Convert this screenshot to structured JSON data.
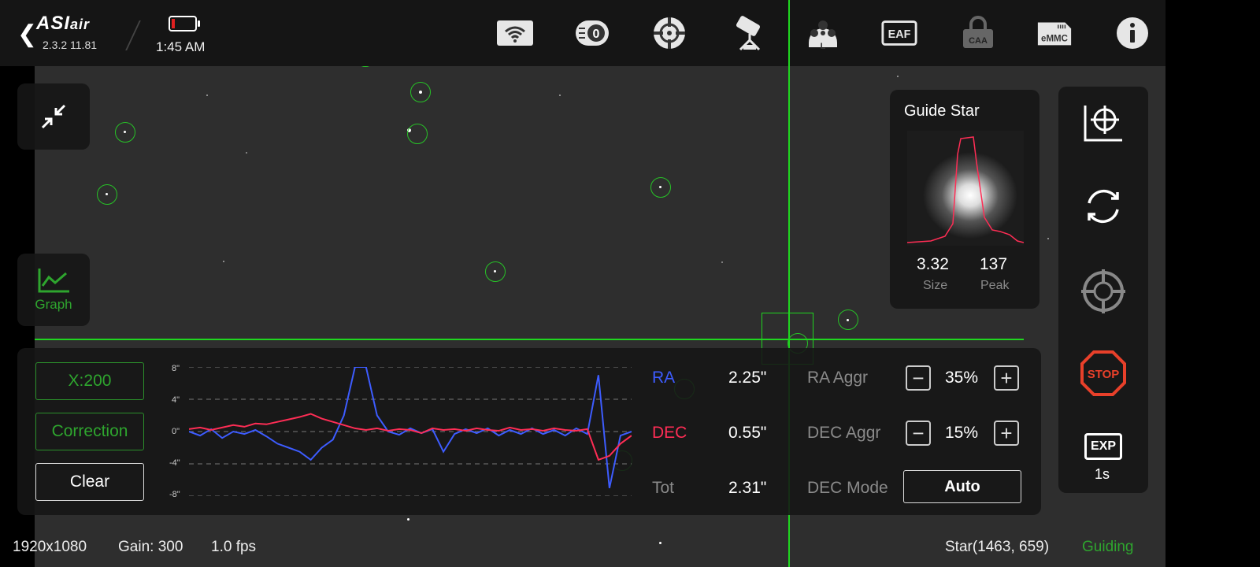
{
  "app": {
    "name": "ASIair",
    "version": "2.3.2 11.81",
    "time": "1:45 AM"
  },
  "toolbar_icons": [
    "wifi-icon",
    "focuser-0-icon",
    "crosshair-target-icon",
    "telescope-mount-icon",
    "filter-wheel-L-icon",
    "eaf-icon",
    "caa-icon",
    "emmc-icon",
    "info-icon"
  ],
  "toolbar_text": {
    "filter": "L",
    "eaf": "EAF",
    "caa": "CAA",
    "emmc": "eMMC"
  },
  "left": {
    "graph_label": "Graph"
  },
  "guide_star": {
    "title": "Guide Star",
    "size_value": "3.32",
    "size_label": "Size",
    "peak_value": "137",
    "peak_label": "Peak"
  },
  "right_panel": {
    "stop_label": "STOP",
    "exp_label": "EXP",
    "exp_value": "1s"
  },
  "graph": {
    "scale_button": "X:200",
    "correction_button": "Correction",
    "clear_button": "Clear",
    "y_ticks": [
      "8\"",
      "4\"",
      "0\"",
      "-4\"",
      "-8\""
    ],
    "ra_label": "RA",
    "ra_value": "2.25\"",
    "dec_label": "DEC",
    "dec_value": "0.55\"",
    "tot_label": "Tot",
    "tot_value": "2.31\"",
    "ra_aggr_label": "RA Aggr",
    "ra_aggr_value": "35%",
    "dec_aggr_label": "DEC Aggr",
    "dec_aggr_value": "15%",
    "dec_mode_label": "DEC Mode",
    "dec_mode_value": "Auto",
    "minus": "−",
    "plus": "+"
  },
  "status": {
    "resolution": "1920x1080",
    "gain": "Gain: 300",
    "fps": "1.0 fps",
    "star": "Star(1463, 659)",
    "state": "Guiding"
  },
  "colors": {
    "accent_green": "#2ea52e",
    "crosshair": "#1fd61f",
    "ra": "#3d5cff",
    "dec": "#ff2d55",
    "stop": "#e8402a"
  },
  "chart_data": {
    "type": "line",
    "ylim": [
      -8,
      8
    ],
    "x": [
      0,
      5,
      10,
      15,
      20,
      25,
      30,
      35,
      40,
      45,
      50,
      55,
      60,
      65,
      70,
      75,
      80,
      85,
      90,
      95,
      100,
      105,
      110,
      115,
      120,
      125,
      130,
      135,
      140,
      145,
      150,
      155,
      160,
      165,
      170,
      175,
      180,
      185,
      190,
      195,
      200
    ],
    "series": [
      {
        "name": "RA",
        "values": [
          0,
          -0.5,
          0.3,
          -0.8,
          0,
          -0.3,
          0.2,
          -0.6,
          -1.5,
          -2,
          -2.5,
          -3.5,
          -2,
          -1,
          2,
          8,
          8,
          2,
          0,
          -0.4,
          0.4,
          -0.2,
          0.3,
          -2.5,
          -0.3,
          0.3,
          -0.2,
          0.4,
          -0.5,
          0.2,
          -0.3,
          0.4,
          -0.3,
          0.2,
          -0.5,
          0.4,
          -0.3,
          7,
          -7,
          -0.5,
          0
        ]
      },
      {
        "name": "DEC",
        "values": [
          0.3,
          0.5,
          0.2,
          0.5,
          0.8,
          0.6,
          1,
          0.9,
          1.2,
          1.5,
          1.8,
          2.2,
          1.6,
          1.2,
          0.8,
          0.4,
          0.2,
          0.4,
          0.1,
          0.3,
          0.2,
          -0.2,
          0.4,
          0.2,
          0.3,
          0.1,
          0.4,
          0.2,
          0.1,
          0.5,
          0.2,
          0.3,
          0.1,
          0.4,
          0.2,
          0.1,
          0.3,
          -3.5,
          -3,
          -1.5,
          -0.5
        ]
      }
    ]
  }
}
